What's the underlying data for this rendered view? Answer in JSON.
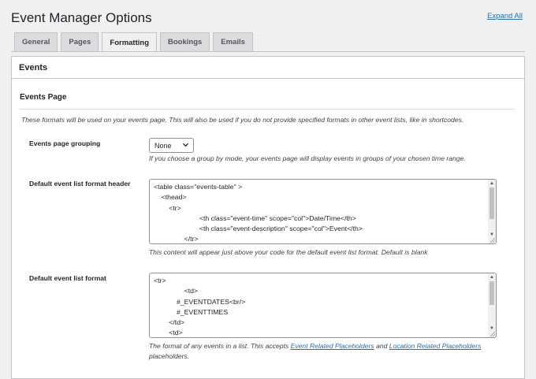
{
  "page": {
    "title": "Event Manager Options",
    "expand_all": "Expand All"
  },
  "tabs": [
    {
      "label": "General",
      "active": false
    },
    {
      "label": "Pages",
      "active": false
    },
    {
      "label": "Formatting",
      "active": true
    },
    {
      "label": "Bookings",
      "active": false
    },
    {
      "label": "Emails",
      "active": false
    }
  ],
  "panel": {
    "title": "Events",
    "section_title": "Events Page",
    "section_desc": "These formats will be used on your events page. This will also be used if you do not provide specified formats in other event lists, like in shortcodes."
  },
  "fields": {
    "grouping": {
      "label": "Events page grouping",
      "selected": "None",
      "help": "If you choose a group by mode, your events page will display events in groups of your chosen time range."
    },
    "list_header": {
      "label": "Default event list format header",
      "value": "<table class=\"events-table\" >\n    <thead>\n        <tr>\n                        <th class=\"event-time\" scope=\"col\">Date/Time</th>\n                        <th class=\"event-description\" scope=\"col\">Event</th>\n                </tr>",
      "help": "This content will appear just above your code for the default event list format. Default is blank"
    },
    "list_format": {
      "label": "Default event list format",
      "value": "<tr>\n                <td>\n            #_EVENTDATES<br/>\n            #_EVENTTIMES\n        </td>\n        <td>",
      "help_before": "The format of any events in a list. This accepts",
      "help_link1": "Event Related Placeholders",
      "help_mid": "and",
      "help_link2": "Location Related Placeholders",
      "help_after": "placeholders."
    }
  },
  "colors": {
    "link": "#2271b1",
    "background": "#f0f0f1",
    "panel": "#ffffff"
  },
  "icons": {
    "select_chevron": "chevron-down-icon",
    "scroll_up": "arrow-up-icon",
    "scroll_down": "arrow-down-icon",
    "resize": "resize-grip-icon"
  }
}
